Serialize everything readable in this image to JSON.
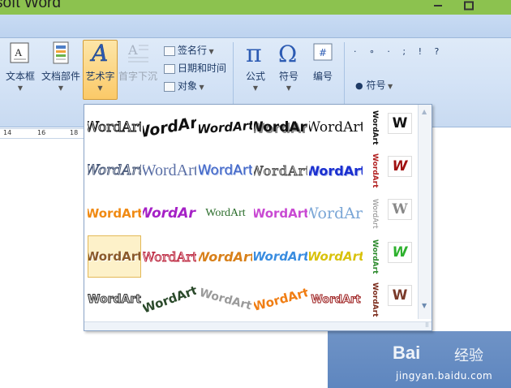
{
  "window": {
    "title": "soft Word"
  },
  "ribbon": {
    "textbox_label": "文本框",
    "docparts_label": "文档部件",
    "wordart_label": "艺术字",
    "dropcap_label": "首字下沉",
    "signature_label": "签名行",
    "datetime_label": "日期和时间",
    "object_label": "对象",
    "equation_label": "公式",
    "symbol_label": "符号",
    "number_label": "编号",
    "special_symbol_label": "符号",
    "special_chars": "· ∘ ·  ; ! ?"
  },
  "ruler": {
    "ticks": [
      "14",
      "16",
      "18"
    ]
  },
  "gallery": {
    "sample_text": "WordArt",
    "vertical_sample": "WordArt",
    "w_sample": "W",
    "selected_index": 15
  },
  "watermark": {
    "logo": "Bai",
    "logo_suffix": "经验",
    "url": "jingyan.baidu.com"
  },
  "colors": {
    "title_bar": "#8cc24f",
    "ribbon": "#d4e3f6",
    "accent_selected": "#fbc968"
  }
}
